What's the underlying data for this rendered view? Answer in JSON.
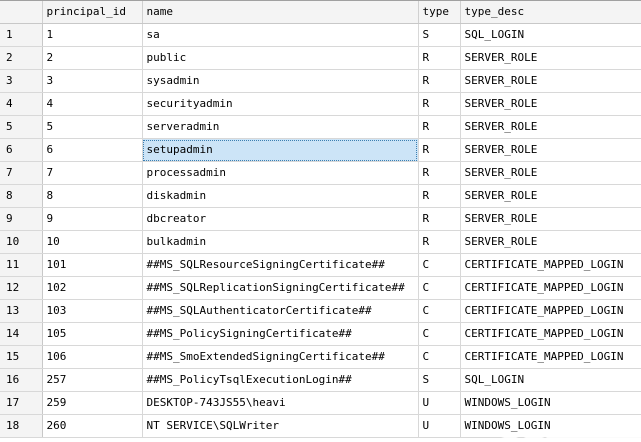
{
  "columns": [
    "principal_id",
    "name",
    "type",
    "type_desc"
  ],
  "selected": {
    "row": 5,
    "column": "name"
  },
  "rows": [
    {
      "num": "1",
      "principal_id": "1",
      "name": "sa",
      "type": "S",
      "type_desc": "SQL_LOGIN"
    },
    {
      "num": "2",
      "principal_id": "2",
      "name": "public",
      "type": "R",
      "type_desc": "SERVER_ROLE"
    },
    {
      "num": "3",
      "principal_id": "3",
      "name": "sysadmin",
      "type": "R",
      "type_desc": "SERVER_ROLE"
    },
    {
      "num": "4",
      "principal_id": "4",
      "name": "securityadmin",
      "type": "R",
      "type_desc": "SERVER_ROLE"
    },
    {
      "num": "5",
      "principal_id": "5",
      "name": "serveradmin",
      "type": "R",
      "type_desc": "SERVER_ROLE"
    },
    {
      "num": "6",
      "principal_id": "6",
      "name": "setupadmin",
      "type": "R",
      "type_desc": "SERVER_ROLE"
    },
    {
      "num": "7",
      "principal_id": "7",
      "name": "processadmin",
      "type": "R",
      "type_desc": "SERVER_ROLE"
    },
    {
      "num": "8",
      "principal_id": "8",
      "name": "diskadmin",
      "type": "R",
      "type_desc": "SERVER_ROLE"
    },
    {
      "num": "9",
      "principal_id": "9",
      "name": "dbcreator",
      "type": "R",
      "type_desc": "SERVER_ROLE"
    },
    {
      "num": "10",
      "principal_id": "10",
      "name": "bulkadmin",
      "type": "R",
      "type_desc": "SERVER_ROLE"
    },
    {
      "num": "11",
      "principal_id": "101",
      "name": "##MS_SQLResourceSigningCertificate##",
      "type": "C",
      "type_desc": "CERTIFICATE_MAPPED_LOGIN"
    },
    {
      "num": "12",
      "principal_id": "102",
      "name": "##MS_SQLReplicationSigningCertificate##",
      "type": "C",
      "type_desc": "CERTIFICATE_MAPPED_LOGIN"
    },
    {
      "num": "13",
      "principal_id": "103",
      "name": "##MS_SQLAuthenticatorCertificate##",
      "type": "C",
      "type_desc": "CERTIFICATE_MAPPED_LOGIN"
    },
    {
      "num": "14",
      "principal_id": "105",
      "name": "##MS_PolicySigningCertificate##",
      "type": "C",
      "type_desc": "CERTIFICATE_MAPPED_LOGIN"
    },
    {
      "num": "15",
      "principal_id": "106",
      "name": "##MS_SmoExtendedSigningCertificate##",
      "type": "C",
      "type_desc": "CERTIFICATE_MAPPED_LOGIN"
    },
    {
      "num": "16",
      "principal_id": "257",
      "name": "##MS_PolicyTsqlExecutionLogin##",
      "type": "S",
      "type_desc": "SQL_LOGIN"
    },
    {
      "num": "17",
      "principal_id": "259",
      "name": "DESKTOP-743JS55\\heavi",
      "type": "U",
      "type_desc": "WINDOWS_LOGIN"
    },
    {
      "num": "18",
      "principal_id": "260",
      "name": "NT SERVICE\\SQLWriter",
      "type": "U",
      "type_desc": "WINDOWS_LOGIN"
    }
  ]
}
